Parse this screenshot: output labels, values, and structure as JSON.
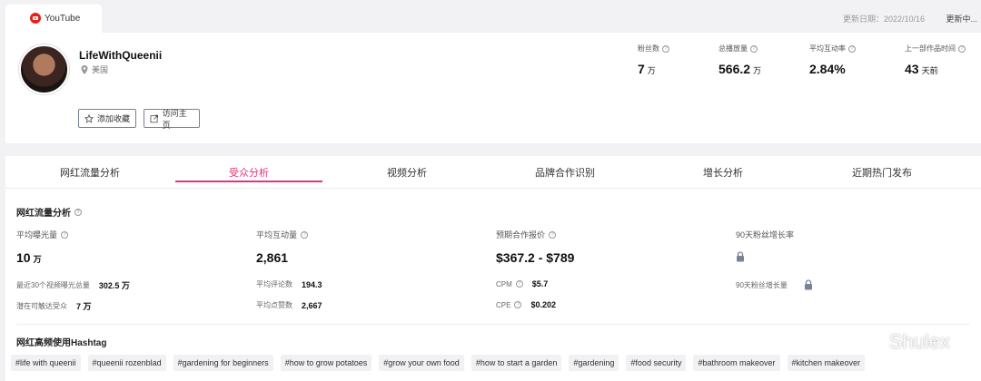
{
  "header": {
    "platform_tab": "YouTube",
    "update_date": "更新日期：2022/10/16",
    "update_status": "更新中..."
  },
  "profile": {
    "name": "LifeWithQueenii",
    "location": "美国",
    "fav_button": "添加收藏",
    "visit_button": "访问主页"
  },
  "stats": [
    {
      "label": "粉丝数",
      "value": "7",
      "unit": "万"
    },
    {
      "label": "总播放量",
      "value": "566.2",
      "unit": "万"
    },
    {
      "label": "平均互动率",
      "value": "2.84%",
      "unit": ""
    },
    {
      "label": "上一部作品时间",
      "value": "43",
      "unit": "天前"
    }
  ],
  "tabs": [
    "网红流量分析",
    "受众分析",
    "视频分析",
    "品牌合作识别",
    "增长分析",
    "近期热门发布"
  ],
  "active_tab": "受众分析",
  "traffic": {
    "title": "网红流量分析",
    "metrics": [
      {
        "label": "平均曝光量",
        "value": "10",
        "unit": "万"
      },
      {
        "label": "平均互动量",
        "value": "2,861",
        "unit": ""
      },
      {
        "label": "预期合作报价",
        "value": "$367.2 - $789",
        "unit": ""
      },
      {
        "label": "90天粉丝增长率",
        "value": "",
        "unit": ""
      }
    ],
    "sub_metrics": {
      "recent30": {
        "label": "最近30个视频曝光总量",
        "value": "302.5 万"
      },
      "potential": {
        "label": "潜在可触达受众",
        "value": "7 万"
      },
      "avg_comments": {
        "label": "平均评论数",
        "value": "194.3"
      },
      "avg_likes": {
        "label": "平均点赞数",
        "value": "2,667"
      },
      "cpm": {
        "label": "CPM",
        "value": "$5.7"
      },
      "cpe": {
        "label": "CPE",
        "value": "$0.202"
      },
      "growth90": {
        "label": "90天粉丝增长量",
        "value": ""
      }
    }
  },
  "hashtag_section": {
    "title": "网红高频使用Hashtag",
    "tags": [
      "#life with queenii",
      "#queenii rozenblad",
      "#gardening for beginners",
      "#how to grow potatoes",
      "#grow your own food",
      "#how to start a garden",
      "#gardening",
      "#food security",
      "#bathroom makeover",
      "#kitchen makeover"
    ]
  },
  "watermark": "Shulex",
  "colors": {
    "accent": "#e6327a",
    "youtube_red": "#e62117"
  }
}
